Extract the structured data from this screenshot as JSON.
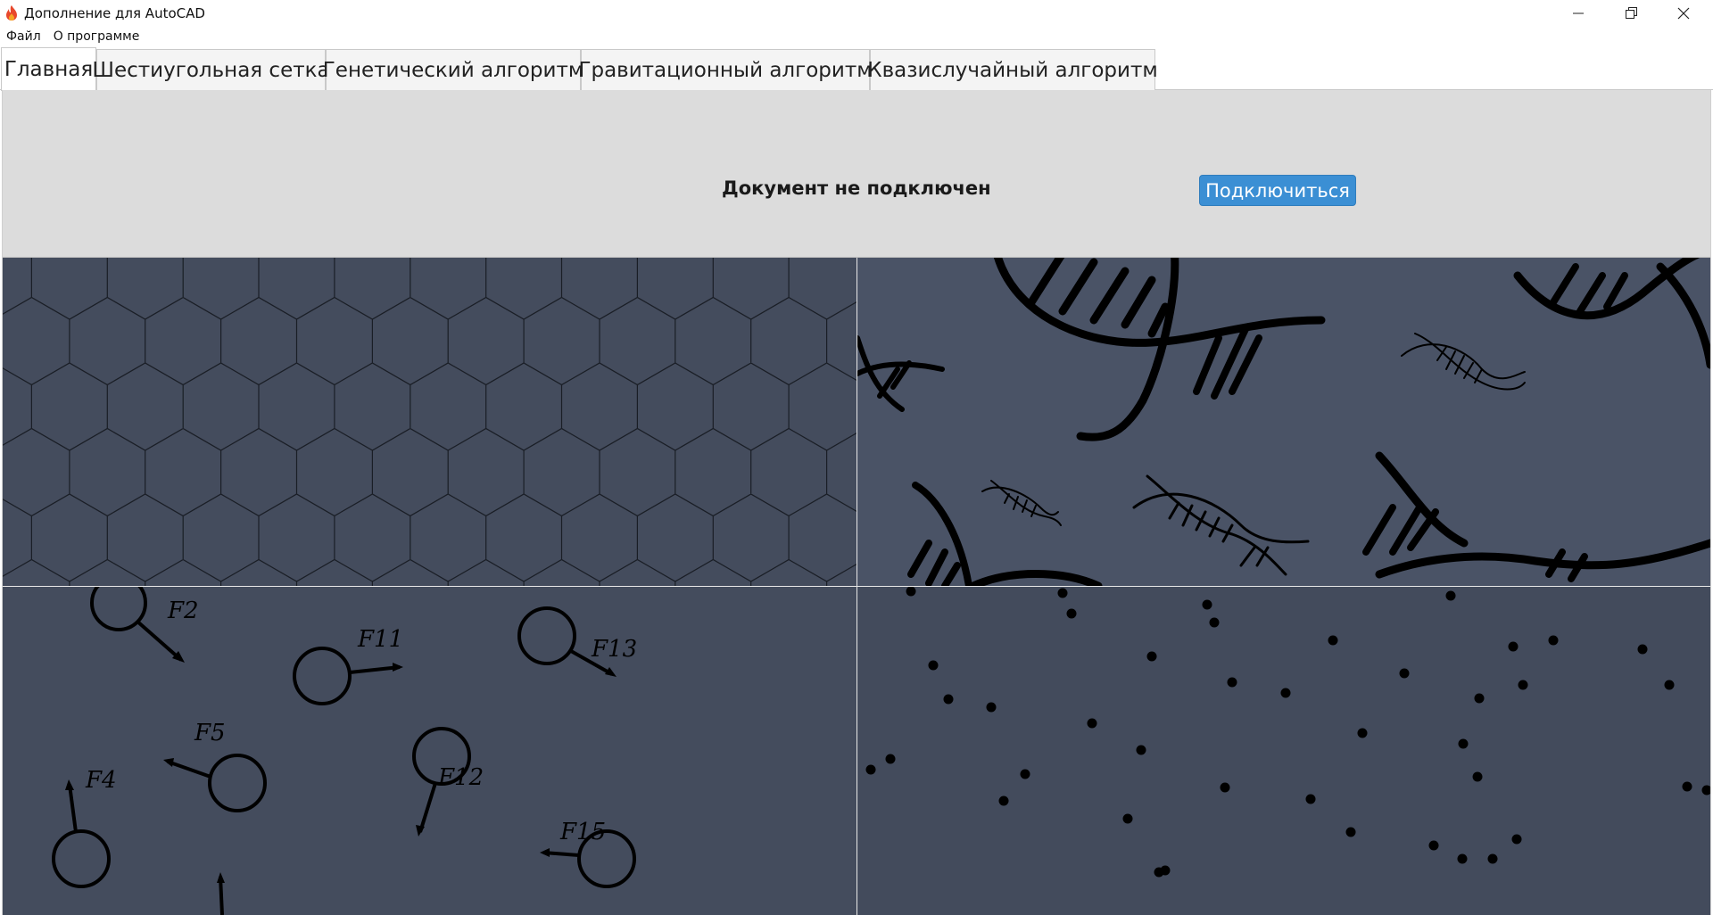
{
  "window": {
    "title": "Дополнение для AutoCAD",
    "icon": "flame-icon"
  },
  "menu": {
    "items": [
      "Файл",
      "О программе"
    ]
  },
  "tabs": [
    {
      "label": "Главная",
      "active": true
    },
    {
      "label": "Шестиугольная сетка",
      "active": false
    },
    {
      "label": "Генетический алгоритм",
      "active": false
    },
    {
      "label": "Гравитационный алгоритм",
      "active": false
    },
    {
      "label": "Квазислучайный алгоритм",
      "active": false
    }
  ],
  "main": {
    "status_text": "Документ не подключен",
    "connect_label": "Подключиться"
  },
  "tiles": {
    "gravity_labels": [
      "F2",
      "F11",
      "F13",
      "F5",
      "F12",
      "F4",
      "F15"
    ]
  },
  "colors": {
    "accent": "#3b8fd4",
    "tile_bg": "#444c5d",
    "status_bg": "#dcdcdc"
  }
}
